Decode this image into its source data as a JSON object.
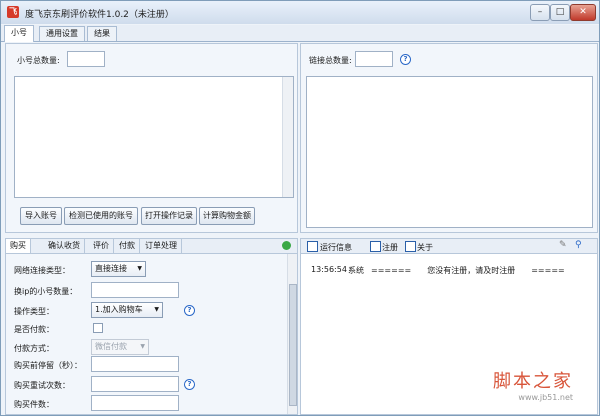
{
  "window": {
    "title": "度飞京东刷评价软件1.0.2（未注册）",
    "minimize": "–",
    "restore": "□",
    "close": "✕"
  },
  "main_tabs": [
    "小号",
    "通用设置",
    "结果"
  ],
  "accounts_panel": {
    "count_label": "小号总数量:",
    "buttons": [
      "导入账号",
      "检测已使用的账号",
      "打开操作记录",
      "计算购物金额"
    ]
  },
  "links_panel": {
    "count_label": "链接总数量:"
  },
  "sub_tabs": [
    "购买",
    "确认收货",
    "评价",
    "付款",
    "订单处理"
  ],
  "form": {
    "network_type_label": "网络连接类型：",
    "network_type_value": "直接连接",
    "ip_switch_label": "换ip的小号数量：",
    "op_type_label": "操作类型：",
    "op_type_value": "1.加入购物车",
    "paid_label": "是否付款：",
    "pay_method_label": "付款方式：",
    "pay_method_value": "微信付款",
    "stay_label": "购买前停留（秒）：",
    "retry_label": "购买重试次数：",
    "qty_label": "购买件数："
  },
  "log_tabs": [
    "运行信息",
    "注册",
    "关于"
  ],
  "log_entry": {
    "time": "13:56:54",
    "source": "系统",
    "message": "======　　您没有注册，请及时注册　　====="
  },
  "watermark": {
    "main": "脚本之家",
    "url": "www.jb51.net"
  }
}
